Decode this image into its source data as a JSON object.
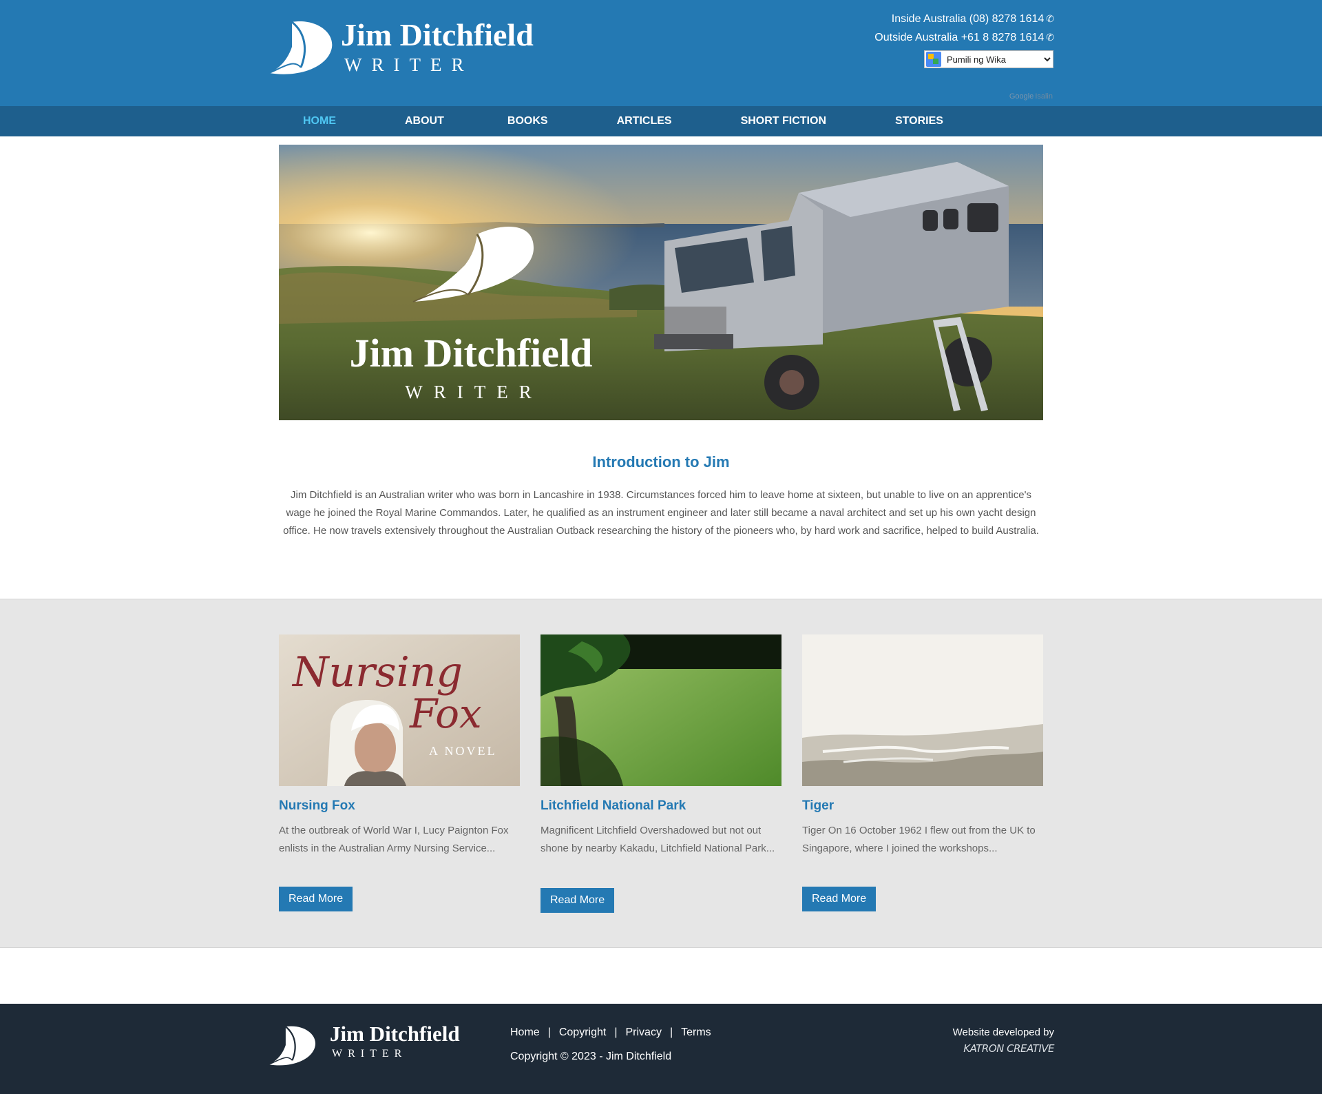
{
  "header": {
    "logo_name": "Jim Ditchfield",
    "logo_sub": "WRITER",
    "phone_inside": "Inside Australia (08) 8278 1614",
    "phone_outside": "Outside Australia +61 8 8278 1614",
    "language_select": "Pumili ng Wika",
    "powered_google": "Google",
    "powered_translate": "Isalin"
  },
  "nav": {
    "items": [
      "HOME",
      "ABOUT",
      "BOOKS",
      "ARTICLES",
      "SHORT FICTION",
      "STORIES"
    ],
    "active": "HOME"
  },
  "hero": {
    "title": "Jim Ditchfield",
    "subtitle": "WRITER"
  },
  "intro": {
    "title": "Introduction to Jim",
    "text": "Jim Ditchfield is an Australian writer who was born in Lancashire in 1938. Circumstances forced him to leave home at sixteen, but unable to live on an apprentice's wage he joined the Royal Marine Commandos. Later, he qualified as an instrument engineer and later still became a naval architect and set up his own yacht design office. He now travels extensively throughout the Australian Outback researching the history of the pioneers who, by hard work and sacrifice, helped to build Australia."
  },
  "cards": [
    {
      "title": "Nursing Fox",
      "excerpt": "At the outbreak of World War I, Lucy Paignton Fox enlists in the Australian Army Nursing Service...",
      "button": "Read More",
      "cover_title_1": "Nursing",
      "cover_title_2": "Fox",
      "cover_sub": "A NOVEL"
    },
    {
      "title": "Litchfield National Park",
      "excerpt": "Magnificent Litchfield Overshadowed but not out shone by nearby Kakadu, Litchfield National Park...",
      "button": "Read More"
    },
    {
      "title": "Tiger",
      "excerpt": "  Tiger On 16 October 1962 I flew out from the UK to Singapore, where I joined the workshops...",
      "button": "Read More"
    }
  ],
  "footer": {
    "logo_name": "Jim Ditchfield",
    "logo_sub": "WRITER",
    "links": [
      "Home",
      "Copyright",
      "Privacy",
      "Terms"
    ],
    "copyright": "Copyright © 2023 - Jim Ditchfield",
    "developed_by": "Website developed by",
    "developer": "KATRON CREATIVE"
  },
  "colors": {
    "header_blue": "#2479b3",
    "nav_blue": "#1e5f8d",
    "nav_active": "#4fc7f3",
    "footer_dark": "#1e2a37",
    "section_grey": "#e6e6e6"
  }
}
